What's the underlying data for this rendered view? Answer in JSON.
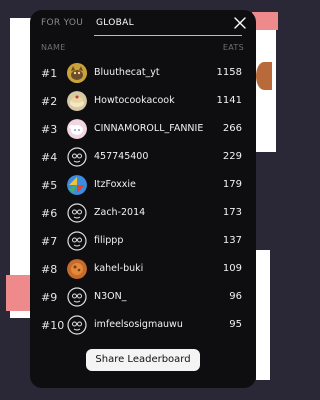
{
  "tabs": {
    "for_you": "FOR YOU",
    "global": "GLOBAL"
  },
  "header": {
    "name": "NAME",
    "eats": "EATS"
  },
  "rows": [
    {
      "rank": "#1",
      "name": "Bluuthecat_yt",
      "eats": "1158",
      "avatar": "cat-avatar"
    },
    {
      "rank": "#2",
      "name": "Howtocookacook",
      "eats": "1141",
      "avatar": "cake-avatar"
    },
    {
      "rank": "#3",
      "name": "CINNAMOROLL_FANNIE",
      "eats": "266",
      "avatar": "bunny-avatar"
    },
    {
      "rank": "#4",
      "name": "457745400",
      "eats": "229",
      "avatar": "default-avatar"
    },
    {
      "rank": "#5",
      "name": "ItzFoxxie",
      "eats": "179",
      "avatar": "colorful-avatar"
    },
    {
      "rank": "#6",
      "name": "Zach-2014",
      "eats": "173",
      "avatar": "default-avatar"
    },
    {
      "rank": "#7",
      "name": "filippp",
      "eats": "137",
      "avatar": "default-avatar"
    },
    {
      "rank": "#8",
      "name": "kahel-buki",
      "eats": "109",
      "avatar": "food-avatar"
    },
    {
      "rank": "#9",
      "name": "N3ON_",
      "eats": "96",
      "avatar": "default-avatar"
    },
    {
      "rank": "#10",
      "name": "imfeelsosigmauwu",
      "eats": "95",
      "avatar": "default-avatar"
    }
  ],
  "share_label": "Share Leaderboard"
}
